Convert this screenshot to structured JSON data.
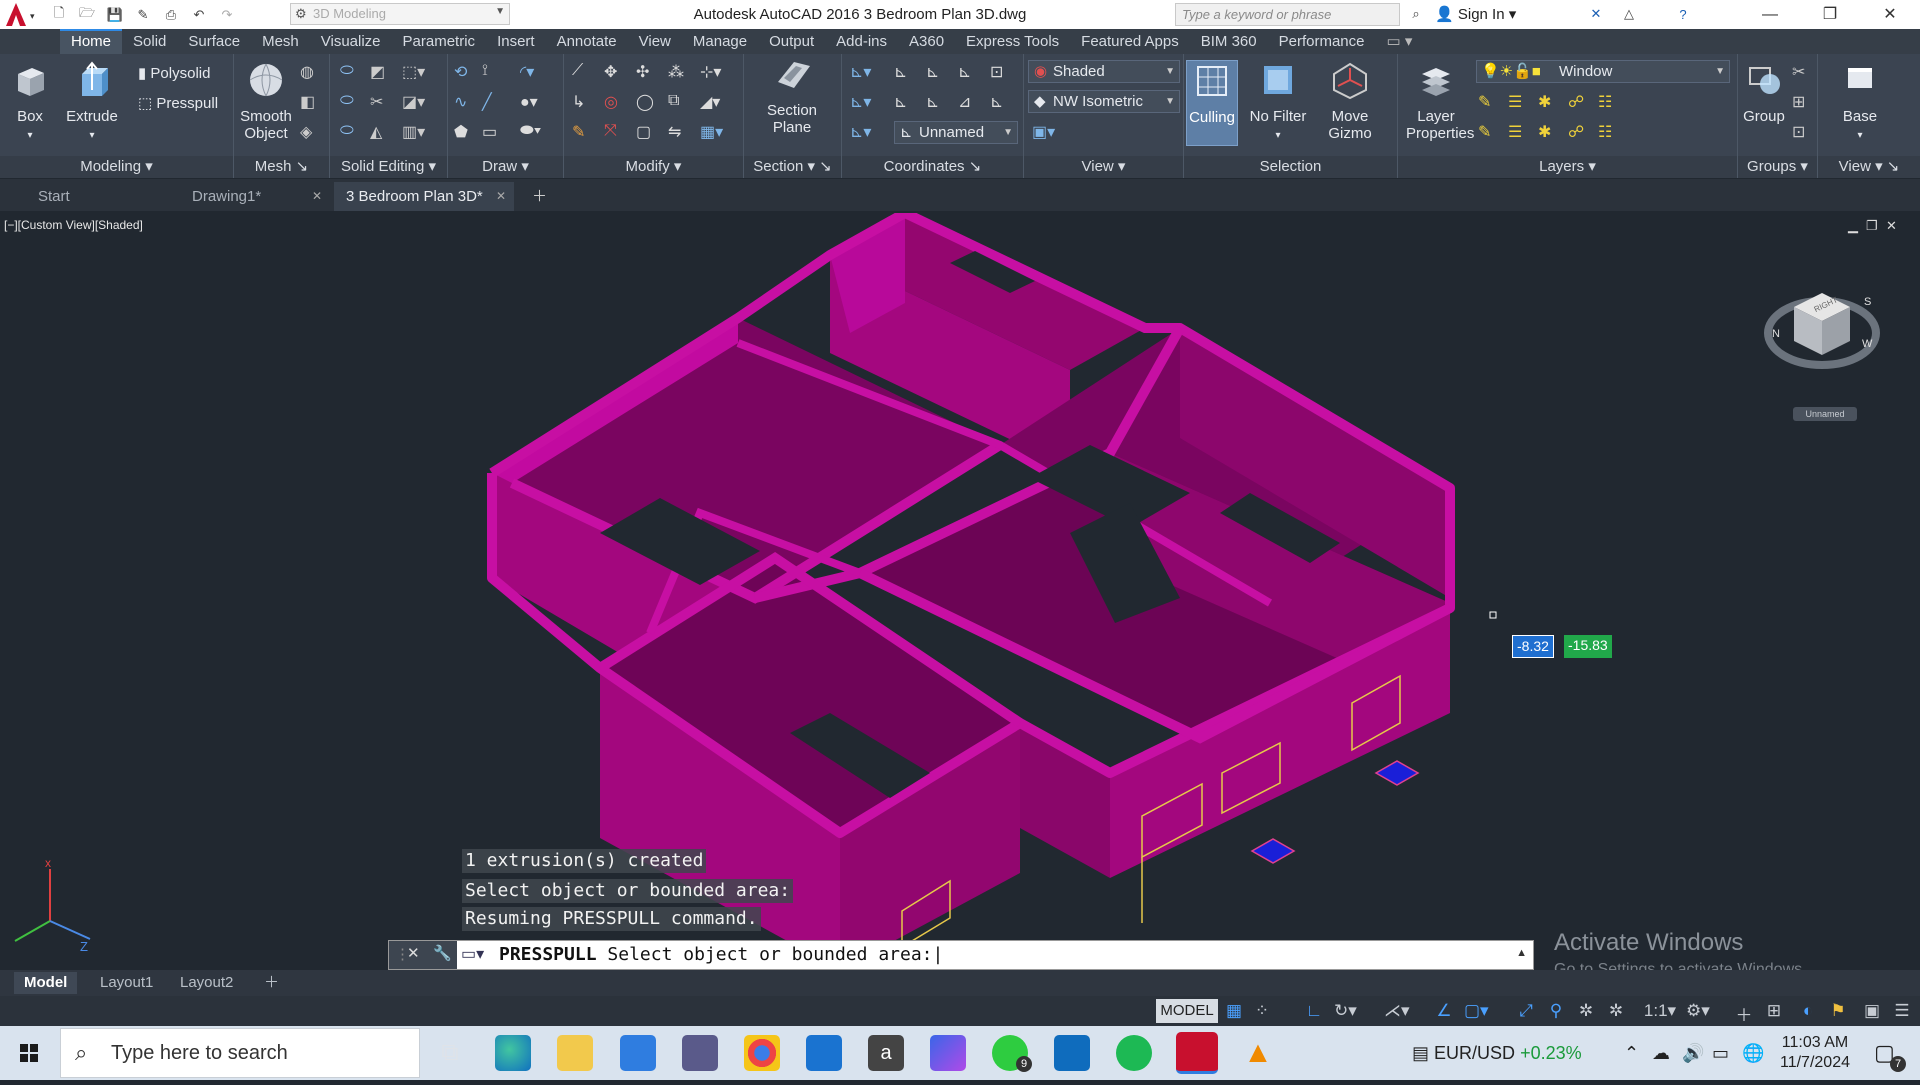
{
  "titlebar": {
    "workspace": "3D Modeling",
    "title": "Autodesk AutoCAD 2016    3 Bedroom Plan 3D.dwg",
    "search_placeholder": "Type a keyword or phrase",
    "signin": "Sign In"
  },
  "ribbon_tabs": [
    "Home",
    "Solid",
    "Surface",
    "Mesh",
    "Visualize",
    "Parametric",
    "Insert",
    "Annotate",
    "View",
    "Manage",
    "Output",
    "Add-ins",
    "A360",
    "Express Tools",
    "Featured Apps",
    "BIM 360",
    "Performance"
  ],
  "ribbon": {
    "box": "Box",
    "extrude": "Extrude",
    "polysolid": "Polysolid",
    "presspull": "Presspull",
    "smooth_object_1": "Smooth",
    "smooth_object_2": "Object",
    "section_plane_1": "Section",
    "section_plane_2": "Plane",
    "visual_style": "Shaded",
    "view_preset": "NW Isometric",
    "ucs": "Unnamed",
    "culling": "Culling",
    "no_filter": "No Filter",
    "move_gizmo_1": "Move",
    "move_gizmo_2": "Gizmo",
    "layer_props_1": "Layer",
    "layer_props_2": "Properties",
    "layer_current": "Window",
    "group": "Group",
    "base": "Base",
    "panels": {
      "modeling": "Modeling",
      "mesh": "Mesh",
      "solid_editing": "Solid Editing",
      "draw": "Draw",
      "modify": "Modify",
      "section": "Section",
      "coordinates": "Coordinates",
      "view": "View",
      "selection": "Selection",
      "layers": "Layers",
      "groups": "Groups",
      "view2": "View"
    }
  },
  "file_tabs": [
    "Start",
    "Drawing1*",
    "3 Bedroom Plan 3D*"
  ],
  "viewport": {
    "label": "[−][Custom View][Shaded]",
    "viewcube_label": "Unnamed",
    "history": [
      "1 extrusion(s) created",
      "Select object or bounded area:",
      "Resuming PRESSPULL command."
    ],
    "dyn_x": "-8.32",
    "dyn_y": "-15.83",
    "activate_title": "Activate Windows",
    "activate_sub": "Go to Settings to activate Windows."
  },
  "command": {
    "name": "PRESSPULL",
    "prompt": "Select object or bounded area:"
  },
  "layout_tabs": [
    "Model",
    "Layout1",
    "Layout2"
  ],
  "status": {
    "model": "MODEL",
    "scale": "1:1"
  },
  "taskbar": {
    "search": "Type here to search",
    "currency_pair": "EUR/USD",
    "currency_change": "+0.23%",
    "time": "11:03 AM",
    "date": "11/7/2024",
    "whatsapp_badge": "9",
    "notif_badge": "7"
  },
  "colors": {
    "wall": "#a1067f",
    "accent_blue": "#2e8ae6",
    "dyn_x_bg": "#1f6fd0",
    "dyn_y_bg": "#21a84a"
  }
}
